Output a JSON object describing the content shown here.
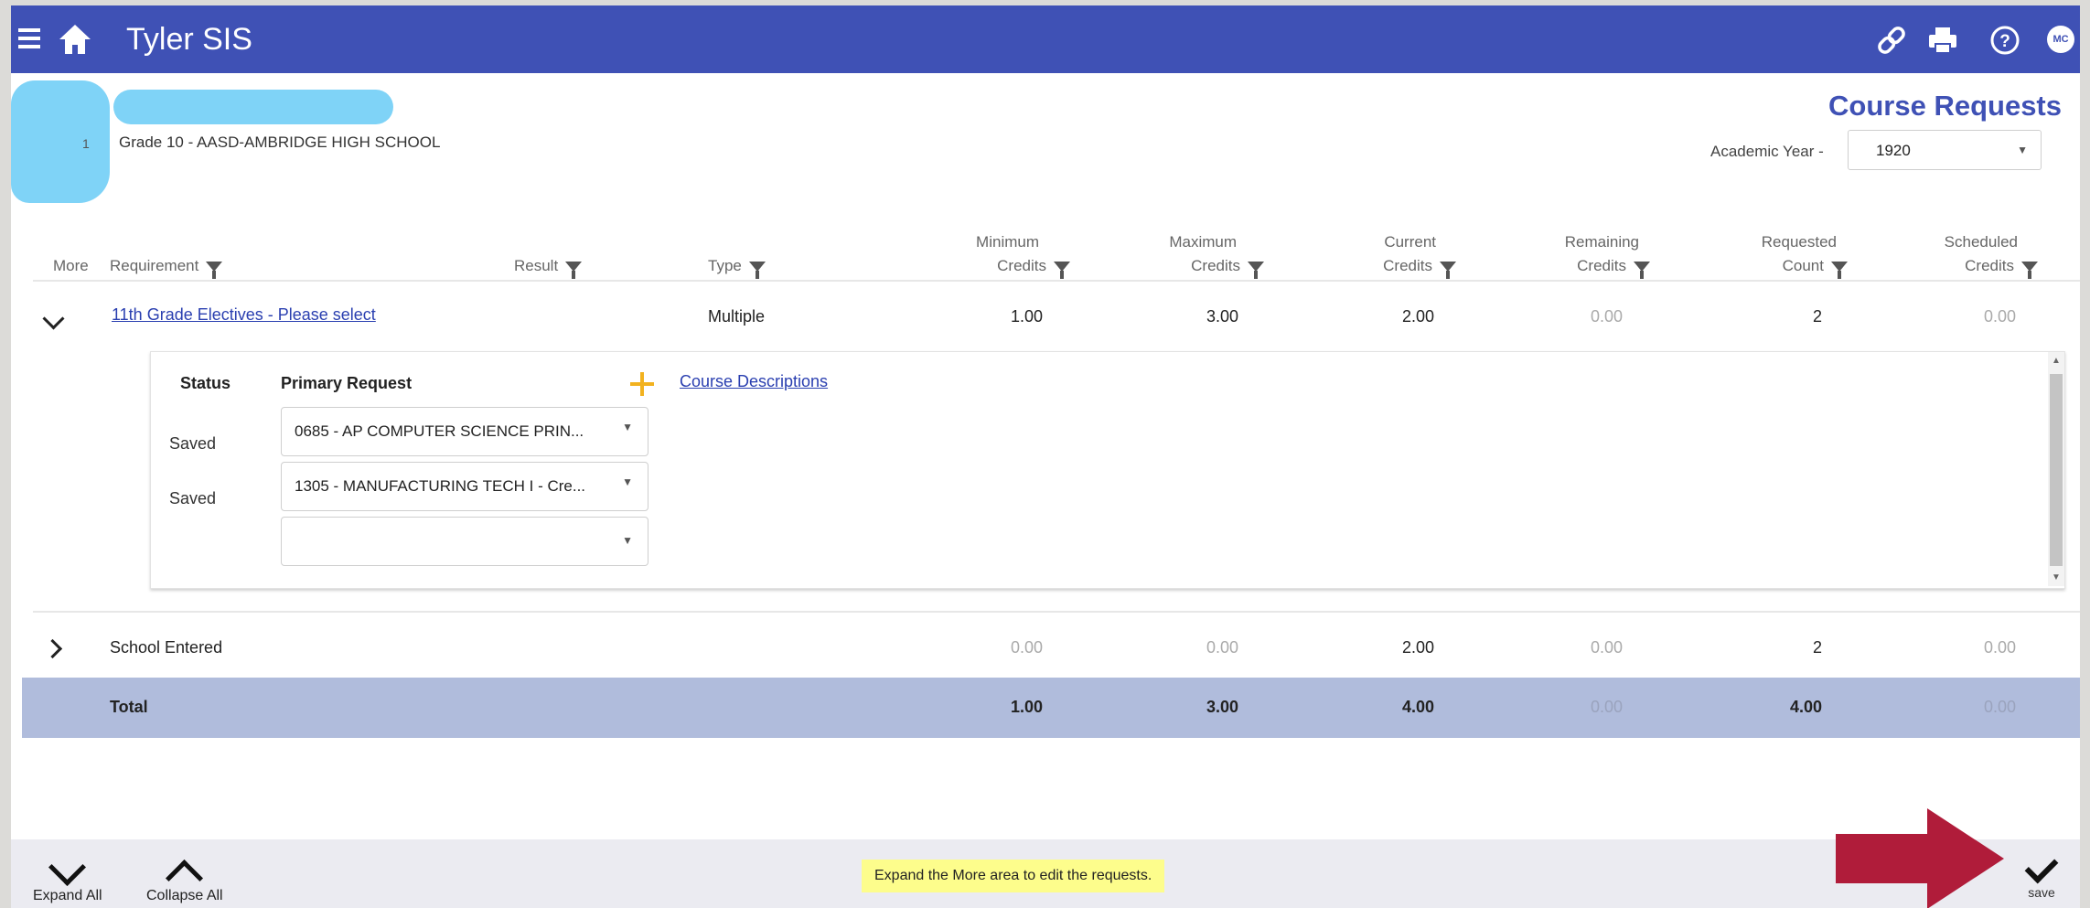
{
  "app": {
    "title": "Tyler SIS",
    "user_initials": "MC"
  },
  "student": {
    "number": "1",
    "grade_school": "Grade 10 - AASD-AMBRIDGE HIGH SCHOOL"
  },
  "page": {
    "heading": "Course Requests",
    "academic_year_label": "Academic Year -",
    "academic_year_value": "1920"
  },
  "table": {
    "headers": {
      "more": "More",
      "requirement": "Requirement",
      "result": "Result",
      "type": "Type",
      "min_1": "Minimum",
      "min_2": "Credits",
      "max_1": "Maximum",
      "max_2": "Credits",
      "cur_1": "Current",
      "cur_2": "Credits",
      "rem_1": "Remaining",
      "rem_2": "Credits",
      "req_1": "Requested",
      "req_2": "Count",
      "sch_1": "Scheduled",
      "sch_2": "Credits"
    },
    "rows": [
      {
        "requirement": "11th Grade Electives - Please select",
        "type": "Multiple",
        "min": "1.00",
        "max": "3.00",
        "current": "2.00",
        "remaining": "0.00",
        "requested": "2",
        "scheduled": "0.00"
      },
      {
        "requirement": "School Entered",
        "min": "0.00",
        "max": "0.00",
        "current": "2.00",
        "remaining": "0.00",
        "requested": "2",
        "scheduled": "0.00"
      }
    ],
    "total": {
      "label": "Total",
      "min": "1.00",
      "max": "3.00",
      "current": "4.00",
      "remaining": "0.00",
      "requested": "4.00",
      "scheduled": "0.00"
    }
  },
  "detail": {
    "status_header": "Status",
    "primary_header": "Primary Request",
    "course_descriptions": "Course Descriptions",
    "requests": [
      {
        "status": "Saved",
        "value": "0685 - AP COMPUTER SCIENCE PRIN..."
      },
      {
        "status": "Saved",
        "value": "1305 - MANUFACTURING TECH I - Cre..."
      },
      {
        "status": "",
        "value": ""
      }
    ]
  },
  "bottom": {
    "expand_all": "Expand All",
    "collapse_all": "Collapse All",
    "hint": "Expand the More area to edit the requests.",
    "save": "save"
  },
  "colors": {
    "brand": "#3f51b5",
    "total_row": "#b0bcdc",
    "hint": "#fdfd8c",
    "arrow": "#b01c3a",
    "plus": "#f2b21f"
  },
  "icons": [
    "menu-icon",
    "home-icon",
    "link-icon",
    "print-icon",
    "help-icon",
    "filter-icon",
    "chevron-down-icon",
    "chevron-right-icon",
    "plus-icon",
    "check-icon"
  ]
}
